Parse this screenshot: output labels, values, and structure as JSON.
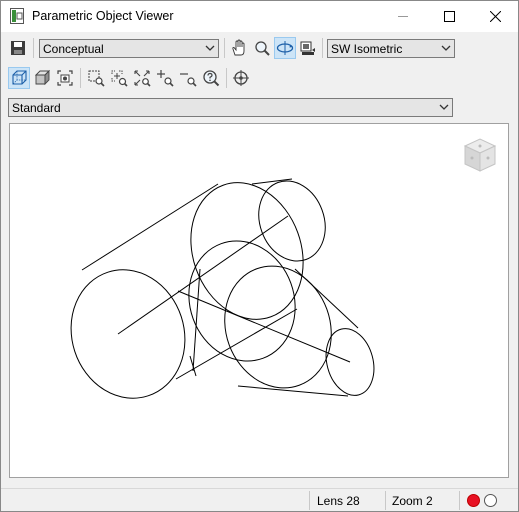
{
  "window": {
    "title": "Parametric Object Viewer"
  },
  "toolbar": {
    "visual_style": "Conceptual",
    "view_preset": "SW Isometric"
  },
  "view_style": {
    "value": "Standard"
  },
  "status": {
    "lens": "Lens 28",
    "zoom": "Zoom 2"
  },
  "colors": {
    "accent": "#cce4f7",
    "active_indicator": "#e81123",
    "inactive_indicator": "#ffffff"
  }
}
